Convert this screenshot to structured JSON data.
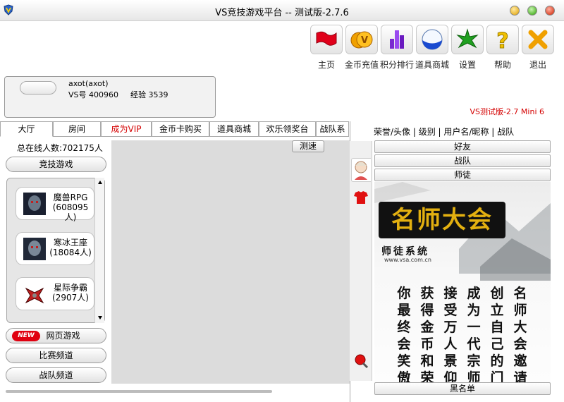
{
  "window": {
    "title": "VS竞技游戏平台 -- 测试版-2.7.6"
  },
  "toolbar": [
    {
      "label": "主页",
      "icon": "home-flag-icon"
    },
    {
      "label": "金币充值",
      "icon": "gold-coin-icon"
    },
    {
      "label": "积分排行",
      "icon": "ranking-icon"
    },
    {
      "label": "道具商城",
      "icon": "item-store-icon"
    },
    {
      "label": "设置",
      "icon": "settings-star-icon"
    },
    {
      "label": "帮助",
      "icon": "help-question-icon"
    },
    {
      "label": "退出",
      "icon": "exit-x-icon"
    }
  ],
  "user": {
    "name": "axot(axot)",
    "vs_number": "VS号 400960",
    "experience": "经验 3539"
  },
  "version_label": "VS测试版-2.7  Mini 6",
  "tabs": [
    {
      "label": "大厅",
      "active": true
    },
    {
      "label": "房间",
      "active": false
    },
    {
      "label": "成为VIP",
      "active": false,
      "color": "#d40000"
    },
    {
      "label": "金币卡购买",
      "active": false
    },
    {
      "label": "道具商城",
      "active": false
    },
    {
      "label": "欢乐领奖台",
      "active": false
    },
    {
      "label": "战队系",
      "active": false
    }
  ],
  "left": {
    "online_count": "总在线人数:702175人",
    "competitive_button": "竞技游戏",
    "games": [
      {
        "name": "魔兽RPG",
        "players": "(608095人)",
        "icon": "warcraft-portrait-icon"
      },
      {
        "name": "寒冰王座",
        "players": "(18084人)",
        "icon": "frozen-throne-portrait-icon"
      },
      {
        "name": "星际争霸",
        "players": "(2907人)",
        "icon": "starcraft-ship-icon"
      }
    ],
    "web_games_button": "网页游戏",
    "new_badge": "NEW",
    "match_channel_button": "比赛频道",
    "team_channel_button": "战队频道"
  },
  "center": {
    "speed_test_button": "测速"
  },
  "right": {
    "header": "荣誉/头像 | 级别 | 用户名/昵称 | 战队",
    "friends_button": "好友",
    "team_button": "战队",
    "mentor_button": "师徒",
    "blacklist_button": "黑名单",
    "banner": {
      "title": "名师大会",
      "subtitle": "师徒系统",
      "url": "www.vsa.com.cn",
      "columns": [
        "名师大会邀请",
        "创立自己的门",
        "成为一代宗师",
        "接受万人景仰",
        "获得金币和荣",
        "你最终会笑傲"
      ]
    }
  }
}
